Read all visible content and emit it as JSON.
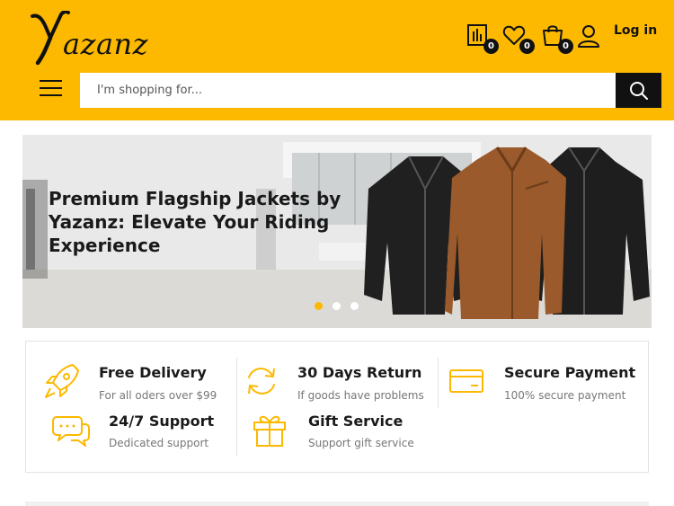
{
  "header": {
    "logo_text": "azanz",
    "compare_count": "0",
    "wishlist_count": "0",
    "cart_count": "0",
    "login_label": "Log in",
    "icons": [
      "compare-icon",
      "heart-icon",
      "shopping-bag-icon",
      "user-icon",
      "menu-icon",
      "search-icon"
    ]
  },
  "search": {
    "placeholder": "I'm shopping for..."
  },
  "banner": {
    "headline": "Premium Flagship Jackets by Yazanz: Elevate Your Riding Experience",
    "slides": 3,
    "active_slide": 1
  },
  "features": [
    {
      "title": "Free Delivery",
      "subtitle": "For all oders over $99",
      "icon": "rocket-icon"
    },
    {
      "title": "30 Days Return",
      "subtitle": "If goods have problems",
      "icon": "refresh-icon"
    },
    {
      "title": "Secure Payment",
      "subtitle": "100% secure payment",
      "icon": "credit-card-icon"
    },
    {
      "title": "24/7 Support",
      "subtitle": "Dedicated support",
      "icon": "chat-icon"
    },
    {
      "title": "Gift Service",
      "subtitle": "Support gift service",
      "icon": "gift-icon"
    }
  ],
  "colors": {
    "brand_yellow": "#fdb900",
    "dark": "#111111",
    "jacket_brown": "#9a5a2b"
  }
}
